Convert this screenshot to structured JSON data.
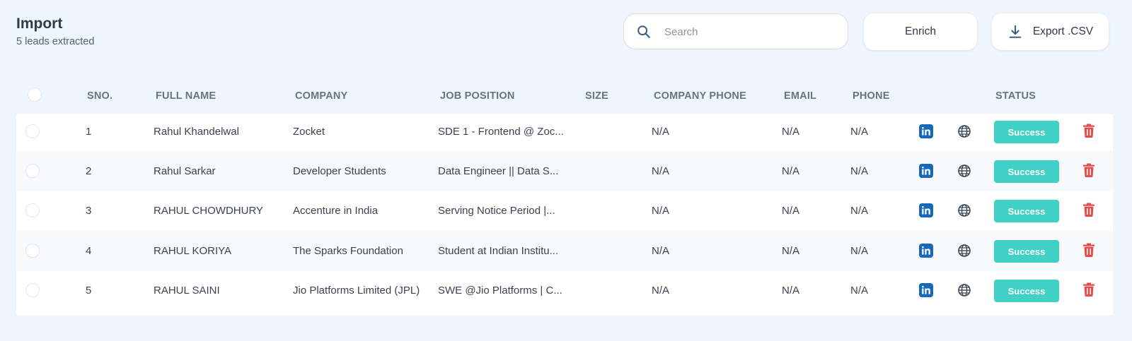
{
  "header": {
    "title": "Import",
    "subtitle": "5 leads extracted"
  },
  "search": {
    "placeholder": "Search",
    "value": ""
  },
  "actions": {
    "enrich_label": "Enrich",
    "export_label": "Export .CSV"
  },
  "colors": {
    "status_success": "#3fd1c6",
    "linkedin": "#1769b8",
    "delete": "#e64b4b"
  },
  "table": {
    "columns": [
      "SNO.",
      "FULL NAME",
      "COMPANY",
      "JOB POSITION",
      "SIZE",
      "COMPANY PHONE",
      "EMAIL",
      "PHONE",
      "STATUS"
    ],
    "rows": [
      {
        "sno": "1",
        "name": "Rahul Khandelwal",
        "company": "Zocket",
        "position": "SDE 1 - Frontend @ Zoc...",
        "size": "",
        "company_phone": "N/A",
        "email": "N/A",
        "phone": "N/A",
        "status": "Success"
      },
      {
        "sno": "2",
        "name": "Rahul Sarkar",
        "company": "Developer Students",
        "position": "Data Engineer || Data S...",
        "size": "",
        "company_phone": "N/A",
        "email": "N/A",
        "phone": "N/A",
        "status": "Success"
      },
      {
        "sno": "3",
        "name": "RAHUL CHOWDHURY",
        "company": "Accenture in India",
        "position": "Serving Notice Period |...",
        "size": "",
        "company_phone": "N/A",
        "email": "N/A",
        "phone": "N/A",
        "status": "Success"
      },
      {
        "sno": "4",
        "name": "RAHUL KORIYA",
        "company": "The Sparks Foundation",
        "position": "Student at Indian Institu...",
        "size": "",
        "company_phone": "N/A",
        "email": "N/A",
        "phone": "N/A",
        "status": "Success"
      },
      {
        "sno": "5",
        "name": "RAHUL SAINI",
        "company": "Jio Platforms Limited (JPL)",
        "position": "SWE @Jio Platforms | C...",
        "size": "",
        "company_phone": "N/A",
        "email": "N/A",
        "phone": "N/A",
        "status": "Success"
      }
    ]
  },
  "icons": {
    "search": "search-icon",
    "download": "download-icon",
    "linkedin": "linkedin-icon",
    "website": "globe-icon",
    "delete": "trash-icon"
  }
}
